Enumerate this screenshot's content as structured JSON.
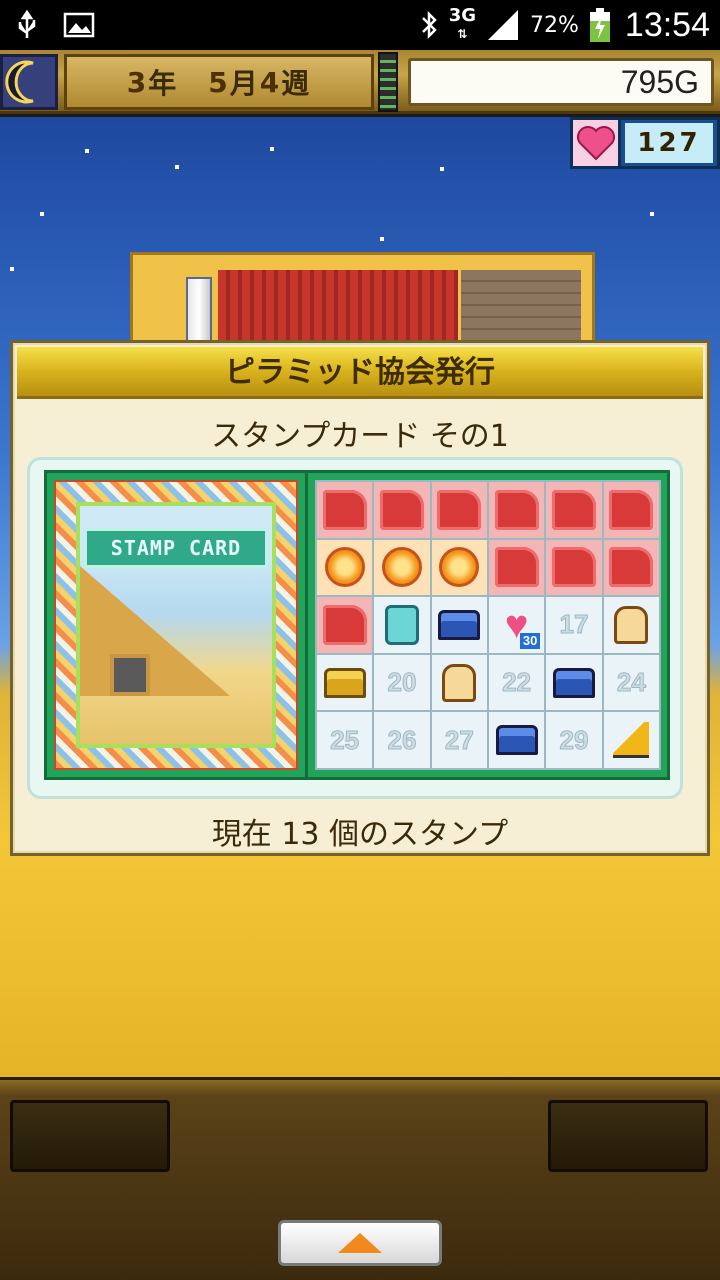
{
  "status_bar": {
    "network": "3G",
    "battery": "72%",
    "time": "13:54",
    "icons": [
      "usb-icon",
      "image-icon",
      "bluetooth-icon",
      "signal-icon",
      "battery-charging-icon"
    ]
  },
  "top_bar": {
    "year": "3",
    "year_unit": "年",
    "month": "5",
    "month_unit": "月",
    "week": "4",
    "week_unit": "週",
    "gold": "795G",
    "moon_icon": "crescent-moon-icon"
  },
  "hearts": {
    "count": "127",
    "icon": "heart-icon"
  },
  "stamp_card": {
    "header": "ピラミッド協会発行",
    "subtitle": "スタンプカード その1",
    "banner": "STAMP CARD",
    "footer": "現在 13 個のスタンプ",
    "stamped": 13,
    "cells": [
      {
        "n": "1",
        "kind": "anubis"
      },
      {
        "n": "2",
        "kind": "anubis"
      },
      {
        "n": "3",
        "kind": "anubis"
      },
      {
        "n": "4",
        "kind": "anubis"
      },
      {
        "n": "5",
        "kind": "anubis"
      },
      {
        "n": "6",
        "kind": "anubis"
      },
      {
        "n": "7",
        "kind": "flame"
      },
      {
        "n": "8",
        "kind": "flame"
      },
      {
        "n": "9",
        "kind": "flame"
      },
      {
        "n": "10",
        "kind": "anubis"
      },
      {
        "n": "11",
        "kind": "anubis"
      },
      {
        "n": "12",
        "kind": "anubis"
      },
      {
        "n": "13",
        "kind": "anubis"
      },
      {
        "n": "14",
        "kind": "phone"
      },
      {
        "n": "15",
        "kind": "chest"
      },
      {
        "n": "16",
        "kind": "heart",
        "badge": "30"
      },
      {
        "n": "17",
        "kind": "number"
      },
      {
        "n": "18",
        "kind": "bread"
      },
      {
        "n": "19",
        "kind": "gold-chest"
      },
      {
        "n": "20",
        "kind": "number"
      },
      {
        "n": "21",
        "kind": "bread"
      },
      {
        "n": "22",
        "kind": "number"
      },
      {
        "n": "23",
        "kind": "chest"
      },
      {
        "n": "24",
        "kind": "number"
      },
      {
        "n": "25",
        "kind": "number"
      },
      {
        "n": "26",
        "kind": "number"
      },
      {
        "n": "27",
        "kind": "number"
      },
      {
        "n": "28",
        "kind": "chest"
      },
      {
        "n": "29",
        "kind": "number"
      },
      {
        "n": "30",
        "kind": "pickaxe"
      }
    ]
  },
  "bottom_bar": {
    "up_icon": "up-arrow-icon"
  }
}
